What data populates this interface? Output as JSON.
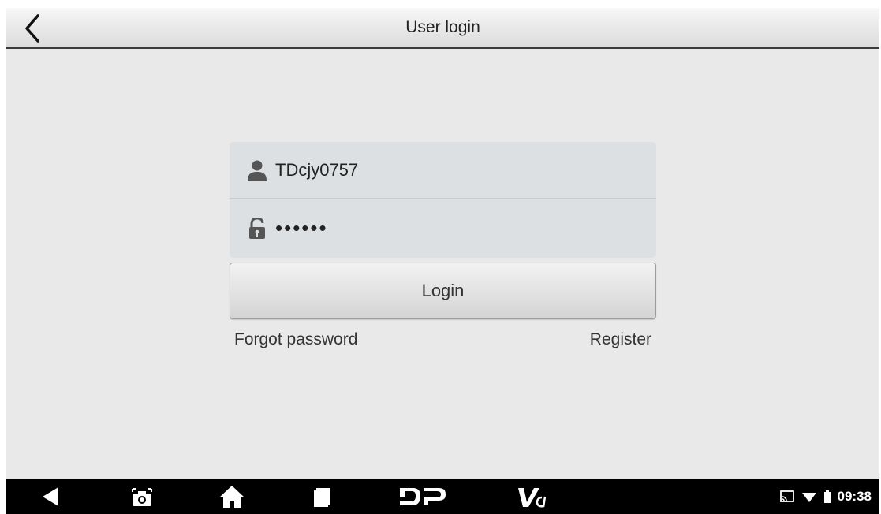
{
  "header": {
    "title": "User login",
    "back_icon": "chevron-left-icon"
  },
  "login": {
    "username_value": "TDcjy0757",
    "username_icon": "user-icon",
    "password_value": "••••••",
    "password_icon": "lock-icon",
    "login_label": "Login",
    "forgot_label": "Forgot password",
    "register_label": "Register"
  },
  "navbar": {
    "icons": [
      "back-triangle-icon",
      "screenshot-icon",
      "home-icon",
      "recents-icon",
      "dp-icon",
      "vci-icon"
    ],
    "status_icons": [
      "cast-icon",
      "wifi-icon",
      "battery-icon"
    ],
    "time": "09:38"
  },
  "colors": {
    "background": "#e9e9e9",
    "field": "#dde0e3",
    "navbar": "#000000"
  }
}
